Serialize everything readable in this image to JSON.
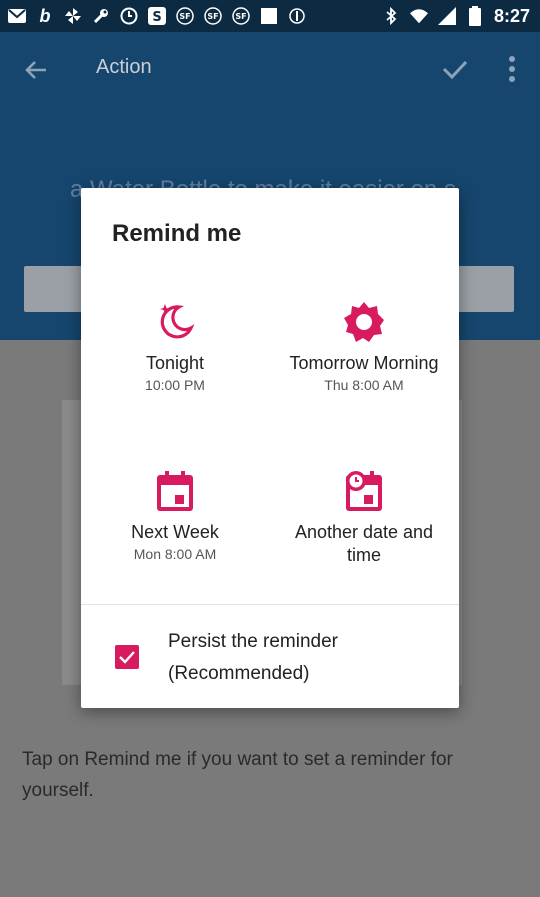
{
  "status_bar": {
    "time": "8:27",
    "icons": [
      "mail-icon",
      "bold-b-icon",
      "pinwheel-icon",
      "wrench-icon",
      "clock-icon",
      "strikethrough-s-icon",
      "sf-icon",
      "sf-icon",
      "sf-icon",
      "square-icon",
      "sync-icon",
      "bluetooth-icon",
      "wifi-icon",
      "signal-icon",
      "battery-icon"
    ]
  },
  "app_bar": {
    "title": "Action",
    "hint": "a Water Bottle to make it easier on s"
  },
  "dialog": {
    "title": "Remind me",
    "options": [
      {
        "name": "Tonight",
        "sub": "10:00 PM",
        "icon": "moon-icon"
      },
      {
        "name": "Tomorrow Morning",
        "sub": "Thu 8:00 AM",
        "icon": "sun-icon"
      },
      {
        "name": "Next Week",
        "sub": "Mon 8:00 AM",
        "icon": "calendar-icon"
      },
      {
        "name": "Another date and time",
        "sub": "",
        "icon": "calendar-clock-icon"
      }
    ],
    "persist_line1": "Persist the reminder",
    "persist_line2": "(Recommended)"
  },
  "background_text": "Tap on Remind me if you want to set a reminder for yourself.",
  "colors": {
    "accent": "#d81b60",
    "app_bar": "#16466d",
    "status_bar": "#0d2a43"
  }
}
